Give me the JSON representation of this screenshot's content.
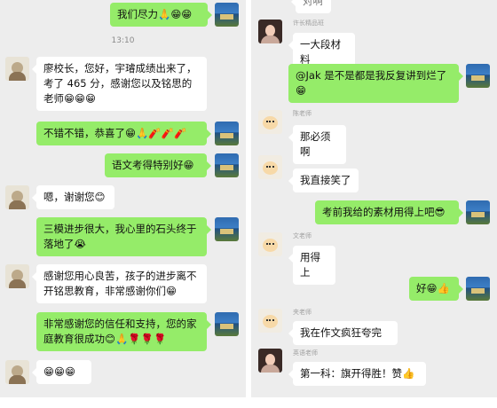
{
  "left": {
    "timestamp": "13:10",
    "messages": [
      "我们尽力🙏😁😁",
      "廖校长，您好，宇璿成绩出来了，考了 465 分，感谢您以及铭思的老师😁😁😁",
      "不错不错，恭喜了😁🙏🧨🧨🧨",
      "语文考得特别好😁",
      "嗯，谢谢您😊",
      "三模进步很大，我心里的石头终于落地了😭",
      "感谢您用心良苦，孩子的进步离不开铭思教育，非常感谢你们😁",
      "非常感谢您的信任和支持，您的家庭教育很成功😊🙏🌹🌹🌹",
      "😁😁😁"
    ]
  },
  "right": {
    "top_partial": "对啊",
    "sender_names": [
      "许长精品班",
      "陈老师",
      "文老师",
      "夹老师",
      "英语老师"
    ],
    "messages": [
      "一大段材料",
      "@Jak 是不是都是我反复讲到烂了😁",
      "那必须啊",
      "我直接笑了",
      "考前我给的素材用得上吧😎",
      "用得上",
      "好😁👍",
      "我在作文疯狂夸完",
      "第一科：旗开得胜！赞👍"
    ]
  }
}
